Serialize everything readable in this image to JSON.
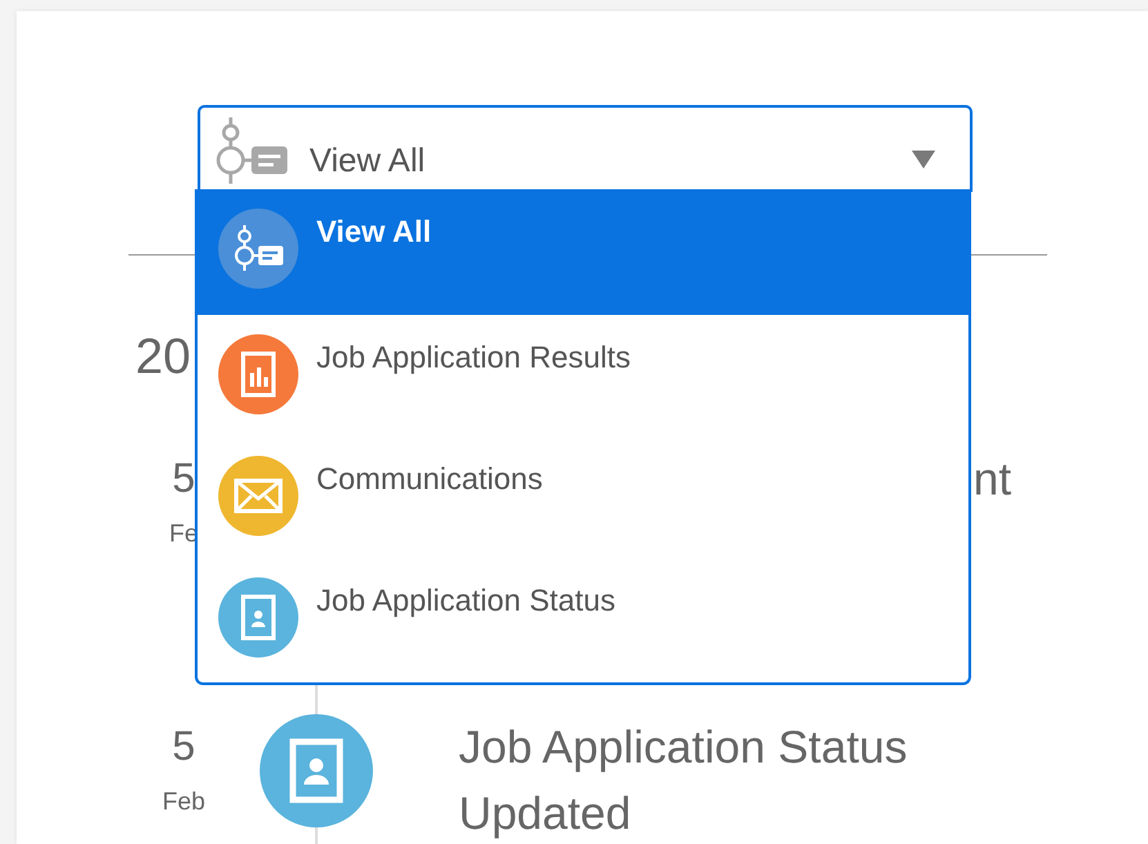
{
  "filter": {
    "value": "View All"
  },
  "menu": {
    "options": [
      {
        "label": "View All",
        "kind": "all",
        "selected": true
      },
      {
        "label": "Job Application Results",
        "kind": "results",
        "selected": false
      },
      {
        "label": "Communications",
        "kind": "mail",
        "selected": false
      },
      {
        "label": "Job Application Status",
        "kind": "status",
        "selected": false
      }
    ]
  },
  "timeline": {
    "year": "20",
    "entries": [
      {
        "day": "5",
        "month": "Fe",
        "title_end": "nt"
      },
      {
        "day": "5",
        "month": "Feb",
        "kind": "status",
        "title": "Job Application Status Updated"
      }
    ]
  }
}
